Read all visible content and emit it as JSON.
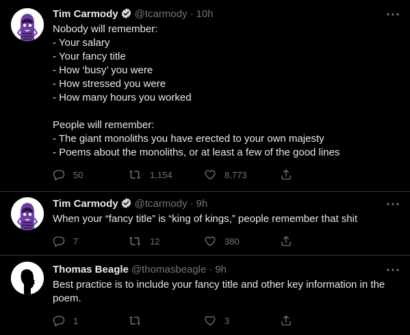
{
  "tweets": [
    {
      "name": "Tim Carmody",
      "handle": "@tcarmody",
      "separator": "·",
      "time": "10h",
      "lines": [
        "Nobody will remember:",
        "- Your salary",
        "- Your fancy title",
        "- How ‘busy’ you were",
        "- How stressed you were",
        "- How many hours you worked",
        "",
        "People will remember:",
        "- The giant monoliths you have erected to your own majesty",
        "- Poems about the monoliths, or at least a few of the good lines"
      ],
      "replies": "50",
      "retweets": "1,154",
      "likes": "8,773"
    },
    {
      "name": "Tim Carmody",
      "handle": "@tcarmody",
      "separator": "·",
      "time": "9h",
      "lines": [
        "When your “fancy title” is “king of kings,” people remember that shit"
      ],
      "replies": "7",
      "retweets": "12",
      "likes": "380"
    },
    {
      "name": "Thomas Beagle",
      "handle": "@thomasbeagle",
      "separator": "·",
      "time": "9h",
      "lines": [
        "Best practice is to include your fancy title and other key information in the poem."
      ],
      "replies": "1",
      "retweets": "",
      "likes": "3"
    }
  ],
  "icons": {
    "verified": "verified-badge-icon",
    "more": "more-horizontal-icon",
    "reply": "reply-icon",
    "retweet": "retweet-icon",
    "like": "like-icon",
    "share": "share-icon"
  },
  "colors": {
    "background": "#000000",
    "primary_text": "#e7e9ea",
    "secondary_text": "#71767b",
    "avatar_purple": "#6b3fa0",
    "divider": "#2f3336"
  }
}
